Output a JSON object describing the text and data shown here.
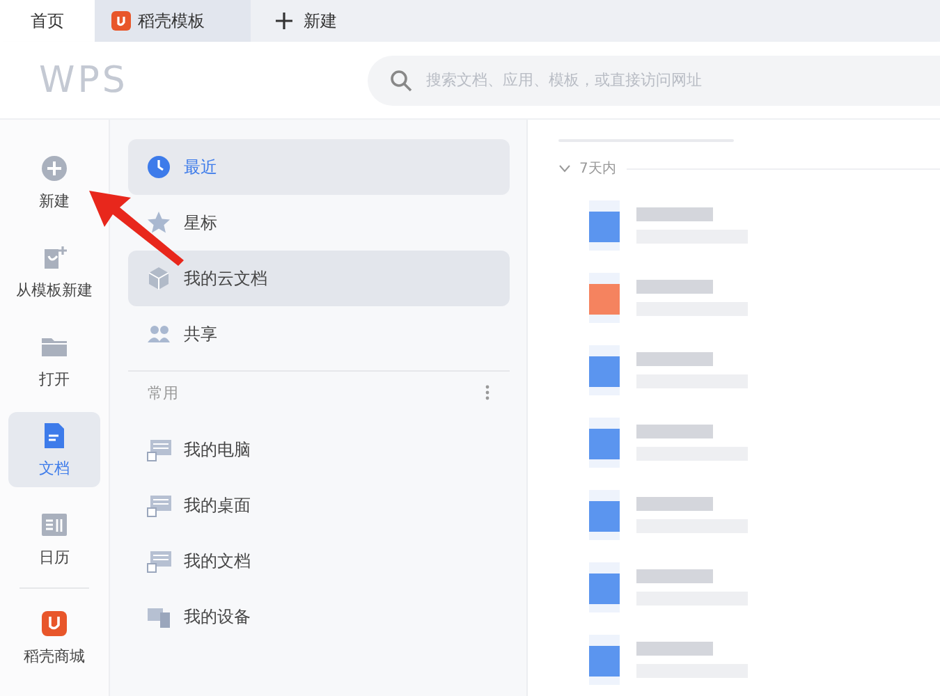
{
  "tabs": [
    {
      "label": "首页",
      "selected": true
    },
    {
      "label": "稻壳模板",
      "selected": false
    }
  ],
  "new_tab": {
    "label": "新建"
  },
  "header": {
    "logo": "WPS",
    "search": {
      "placeholder": "搜索文档、应用、模板，或直接访问网址"
    }
  },
  "rail": [
    {
      "label": "新建",
      "selected": false
    },
    {
      "label": "从模板新建",
      "selected": false
    },
    {
      "label": "打开",
      "selected": false
    },
    {
      "label": "文档",
      "selected": true
    },
    {
      "label": "日历",
      "selected": false
    },
    {
      "label": "稻壳商城",
      "selected": false
    }
  ],
  "nav": [
    {
      "label": "最近",
      "selected": true,
      "hovered": false
    },
    {
      "label": "星标",
      "selected": false,
      "hovered": false
    },
    {
      "label": "我的云文档",
      "selected": false,
      "hovered": true
    },
    {
      "label": "共享",
      "selected": false,
      "hovered": false
    }
  ],
  "common": {
    "title": "常用",
    "items": [
      {
        "label": "我的电脑"
      },
      {
        "label": "我的桌面"
      },
      {
        "label": "我的文档"
      },
      {
        "label": "我的设备"
      }
    ]
  },
  "files": {
    "group": "7天内",
    "expanded": true,
    "rows": [
      {
        "color": "#5b95ef"
      },
      {
        "color": "#f5835f"
      },
      {
        "color": "#5b95ef"
      },
      {
        "color": "#5b95ef"
      },
      {
        "color": "#5b95ef"
      },
      {
        "color": "#5b95ef"
      },
      {
        "color": "#5b95ef"
      }
    ]
  }
}
